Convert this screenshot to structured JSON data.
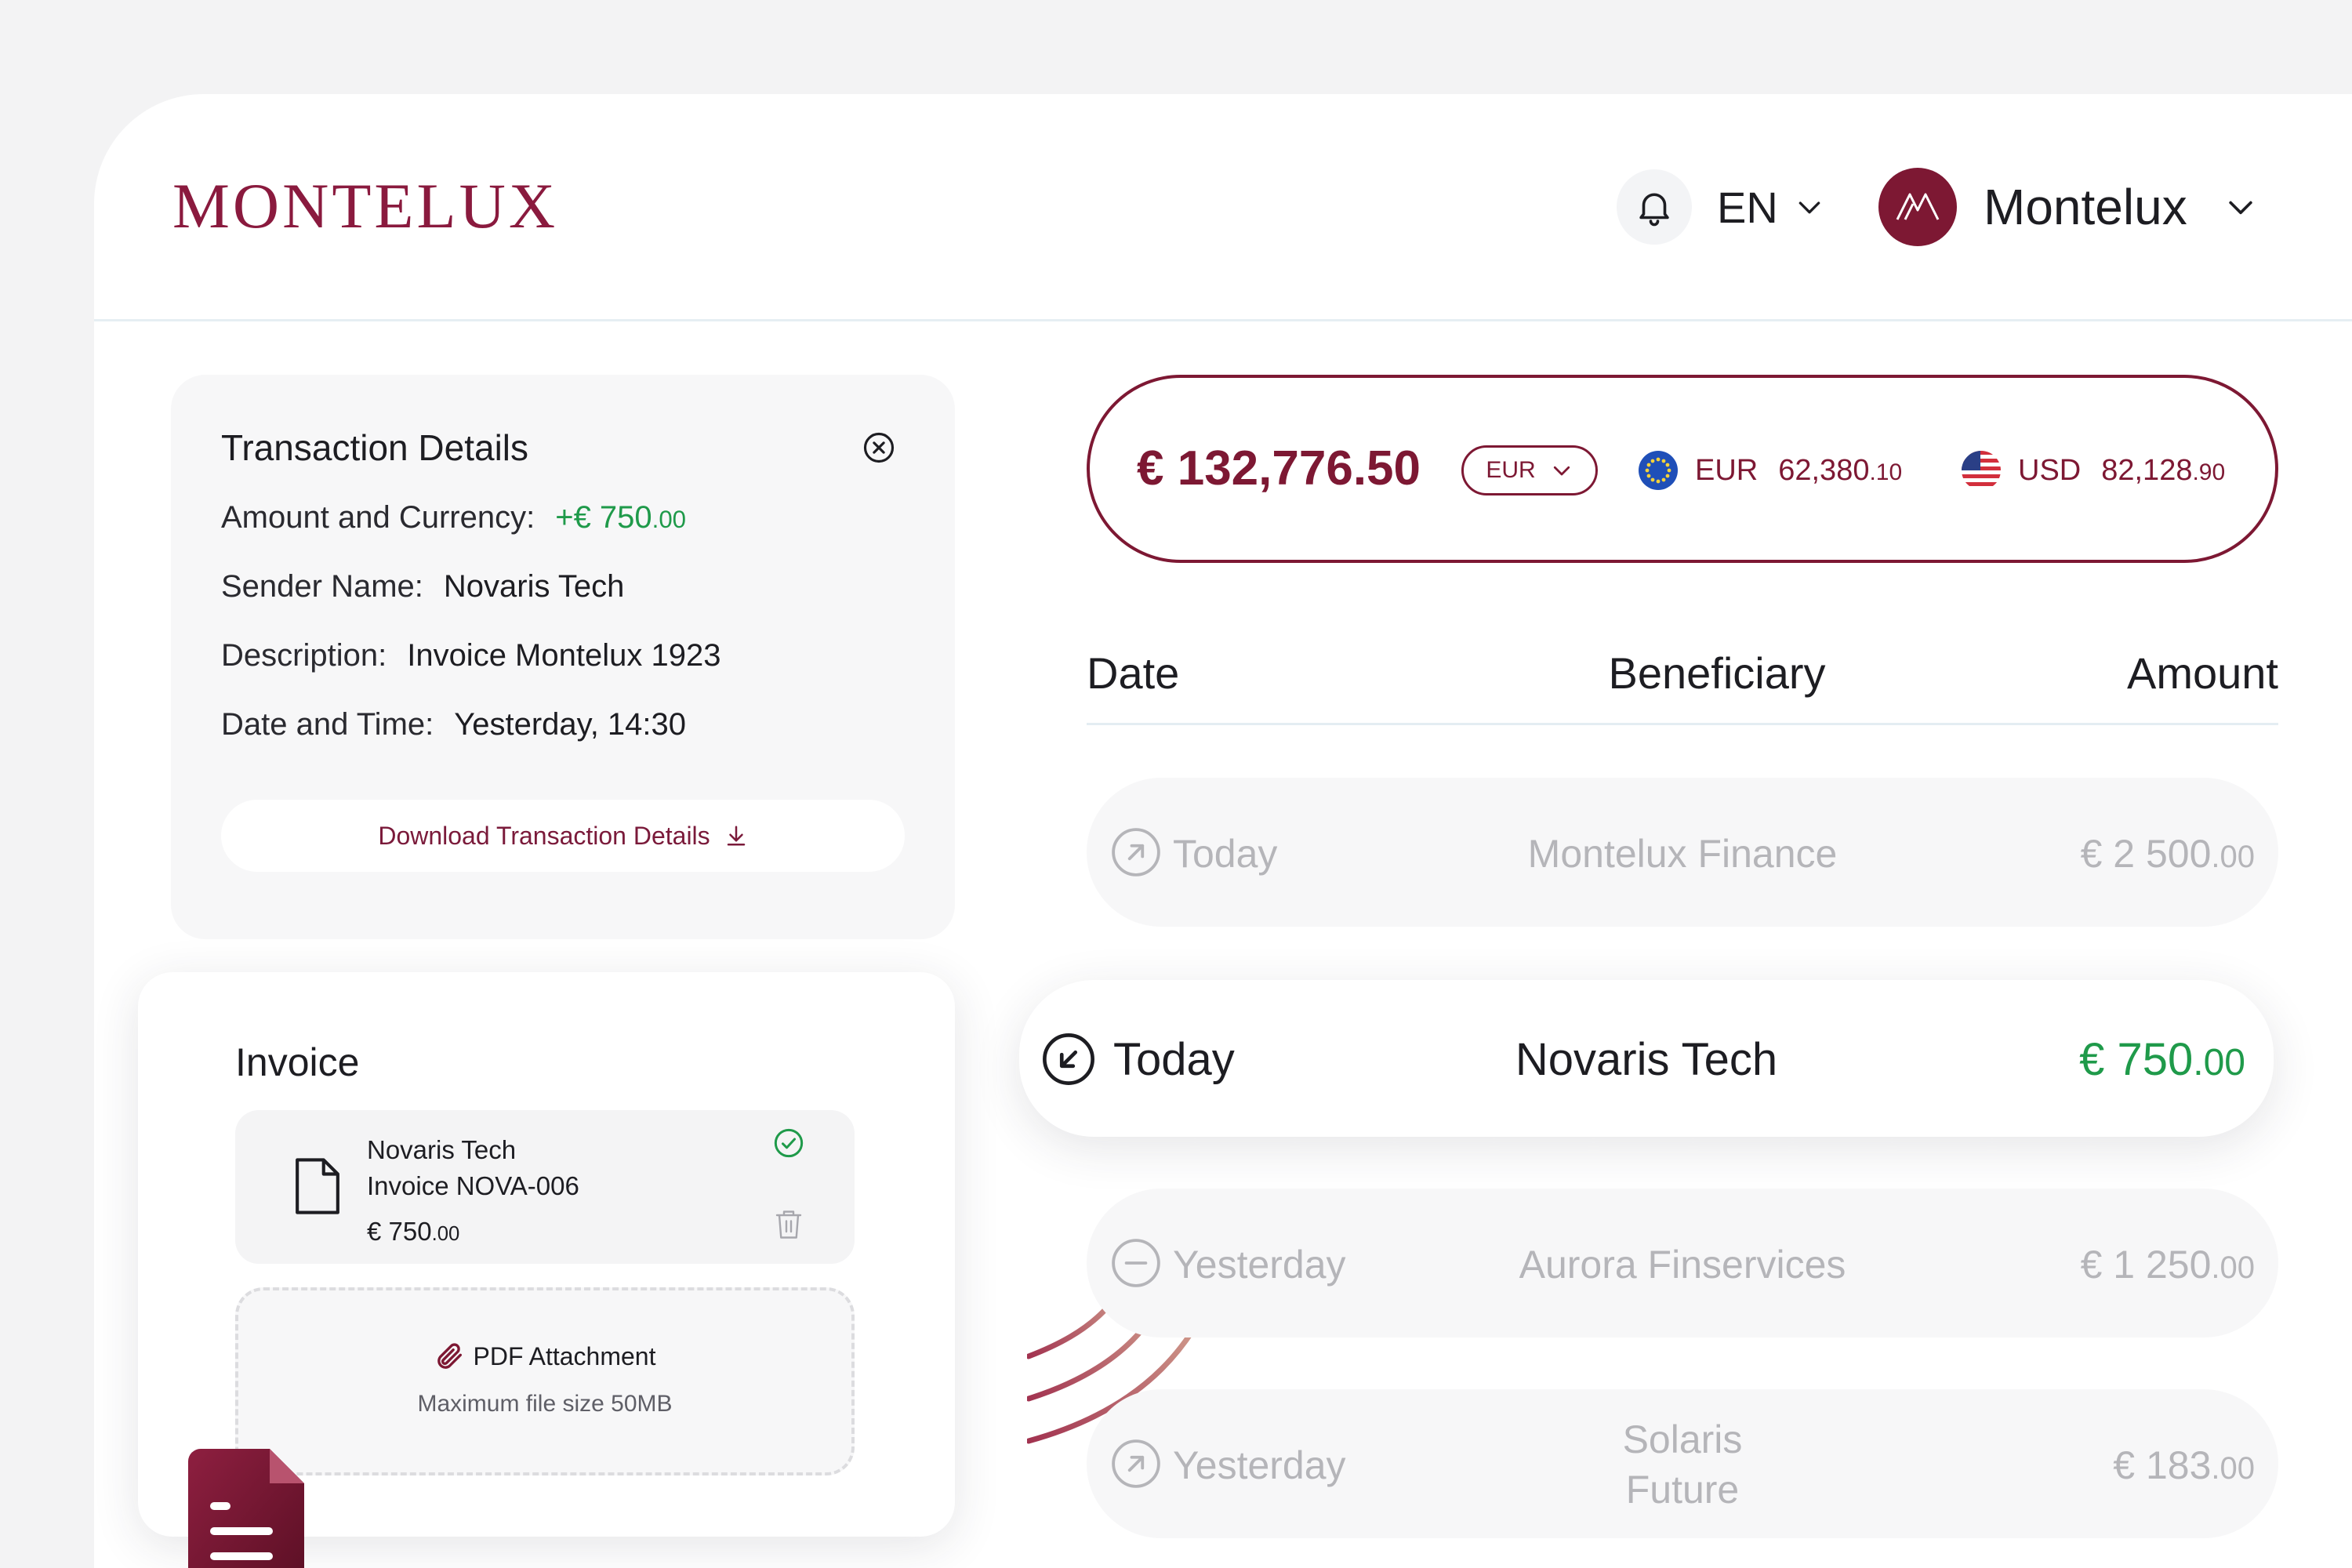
{
  "header": {
    "logo_text": "MONTELUX",
    "language": "EN",
    "account_name": "Montelux"
  },
  "details": {
    "title": "Transaction Details",
    "amount_label": "Amount  and Currency:",
    "amount_main": "+€ 750",
    "amount_dec": ".00",
    "sender_label": "Sender Name:",
    "sender_value": "Novaris Tech",
    "description_label": "Description:",
    "description_value": "Invoice Montelux 1923",
    "datetime_label": "Date and Time:",
    "datetime_value": "Yesterday, 14:30",
    "download_label": "Download Transaction Details"
  },
  "invoice": {
    "title": "Invoice",
    "file_company": "Novaris Tech",
    "file_name": "Invoice NOVA-006",
    "file_amount_main": "€ 750",
    "file_amount_dec": ".00",
    "attachment_label": "PDF Attachment",
    "attachment_hint": "Maximum file size 50MB"
  },
  "balance": {
    "total": "€ 132,776.50",
    "currency_select": "EUR",
    "eur_code": "EUR",
    "eur_main": "62,380",
    "eur_dec": ".10",
    "usd_code": "USD",
    "usd_main": "82,128",
    "usd_dec": ".90"
  },
  "table": {
    "col_date": "Date",
    "col_beneficiary": "Beneficiary",
    "col_amount": "Amount",
    "rows": [
      {
        "date": "Today",
        "beneficiary": "Montelux Finance",
        "amount_main": "€ 2 500",
        "amount_dec": ".00",
        "direction": "outgoing-arrow-icon"
      },
      {
        "date": "Today",
        "beneficiary": "Novaris Tech",
        "amount_main": "€ 750",
        "amount_dec": ".00",
        "direction": "incoming-arrow-icon"
      },
      {
        "date": "Yesterday",
        "beneficiary": "Aurora Finservices",
        "amount_main": "€ 1 250",
        "amount_dec": ".00",
        "direction": "minus-icon"
      },
      {
        "date": "Yesterday",
        "beneficiary_line1": "Solaris",
        "beneficiary_line2": "Future",
        "amount_main": "€ 183",
        "amount_dec": ".00",
        "direction": "outgoing-arrow-icon"
      }
    ]
  },
  "colors": {
    "brand": "#7d1833",
    "positive": "#1f9a4a",
    "muted": "#b5b5b9"
  }
}
